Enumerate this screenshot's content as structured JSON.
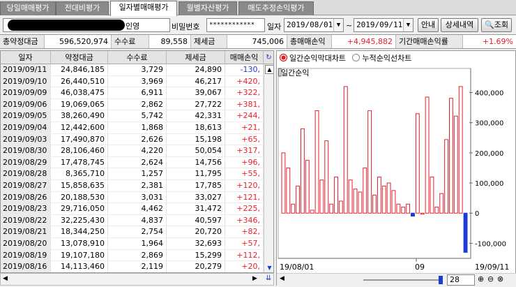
{
  "tabs": [
    {
      "label": "당일매매평가",
      "active": false
    },
    {
      "label": "전대비평가",
      "active": false
    },
    {
      "label": "일자별매매평가",
      "active": true
    },
    {
      "label": "월별자산평가",
      "active": false
    },
    {
      "label": "매도추정손익평가",
      "active": false
    }
  ],
  "account": {
    "name_suffix": "인영"
  },
  "password": {
    "label": "비밀번호",
    "value": "************"
  },
  "date": {
    "label": "일자",
    "start": "2019/08/01",
    "sep": "~",
    "end": "2019/09/11"
  },
  "buttons": {
    "guide": "안내",
    "detail": "상세내역",
    "search": "조회"
  },
  "summary": {
    "total_amount_label": "총약정대금",
    "total_amount": "596,520,974",
    "fee_label": "수수료",
    "fee": "89,558",
    "tax_label": "제세금",
    "tax": "745,006",
    "total_pl_label": "총매매손익",
    "total_pl": "+4,945,882",
    "rate_label": "기간매매손익률",
    "rate": "+1.69%"
  },
  "table": {
    "headers": [
      "일자",
      "약정대금",
      "수수료",
      "제세금",
      "매매손익"
    ],
    "rows": [
      [
        "2019/09/11",
        "24,846,185",
        "3,729",
        "24,890",
        "-130,"
      ],
      [
        "2019/09/10",
        "26,440,510",
        "3,969",
        "46,217",
        "+420,"
      ],
      [
        "2019/09/09",
        "46,038,475",
        "6,911",
        "39,067",
        "+322,"
      ],
      [
        "2019/09/06",
        "19,069,065",
        "2,862",
        "27,722",
        "+381,"
      ],
      [
        "2019/09/05",
        "38,260,490",
        "5,742",
        "42,331",
        "+244,"
      ],
      [
        "2019/09/04",
        "12,442,600",
        "1,868",
        "18,613",
        "+21,"
      ],
      [
        "2019/09/03",
        "17,490,870",
        "2,626",
        "15,198",
        "+65,"
      ],
      [
        "2019/08/30",
        "28,106,460",
        "4,220",
        "50,054",
        "+317,"
      ],
      [
        "2019/08/29",
        "17,478,745",
        "2,624",
        "14,756",
        "+96,"
      ],
      [
        "2019/08/28",
        "8,365,710",
        "1,257",
        "11,795",
        "+55,"
      ],
      [
        "2019/08/27",
        "15,858,635",
        "2,381",
        "17,785",
        "+120,"
      ],
      [
        "2019/08/26",
        "20,188,530",
        "3,031",
        "33,027",
        "+121,"
      ],
      [
        "2019/08/23",
        "29,716,050",
        "4,462",
        "31,472",
        "+225,"
      ],
      [
        "2019/08/22",
        "32,225,430",
        "4,837",
        "40,597",
        "+346,"
      ],
      [
        "2019/08/21",
        "18,344,250",
        "2,754",
        "20,720",
        "+82,"
      ],
      [
        "2019/08/20",
        "13,078,910",
        "1,964",
        "32,693",
        "+57,"
      ],
      [
        "2019/08/19",
        "19,107,180",
        "2,869",
        "15,299",
        "+112,"
      ],
      [
        "2019/08/16",
        "14,113,460",
        "2,119",
        "20,279",
        "+20,"
      ]
    ]
  },
  "chart_options": {
    "daily_bar": "일간순익막대차트",
    "cumulative_line": "누적순익선차트"
  },
  "slider": {
    "value": "28"
  },
  "chart_data": {
    "type": "bar",
    "title": "일간순익",
    "x_start_label": "19/08/01",
    "x_mid_label": "09",
    "x_end_label": "19/09/11",
    "y_ticks": [
      "400,000",
      "300,000",
      "200,000",
      "100,000",
      "0",
      "-100,000"
    ],
    "ylim": [
      -150000,
      480000
    ],
    "values": [
      200000,
      150000,
      30000,
      90000,
      280000,
      175000,
      10000,
      340000,
      110000,
      240000,
      30000,
      120000,
      40000,
      420000,
      110000,
      80000,
      70000,
      150000,
      340000,
      60000,
      120000,
      90000,
      100000,
      75000,
      30000,
      20000,
      30000,
      -10000,
      330000,
      0,
      385000,
      120000,
      20000,
      65000,
      244000,
      381000,
      322000,
      420000,
      -130000
    ],
    "colors": {
      "positive": "#e8202a",
      "negative": "#1a3cd8"
    }
  }
}
